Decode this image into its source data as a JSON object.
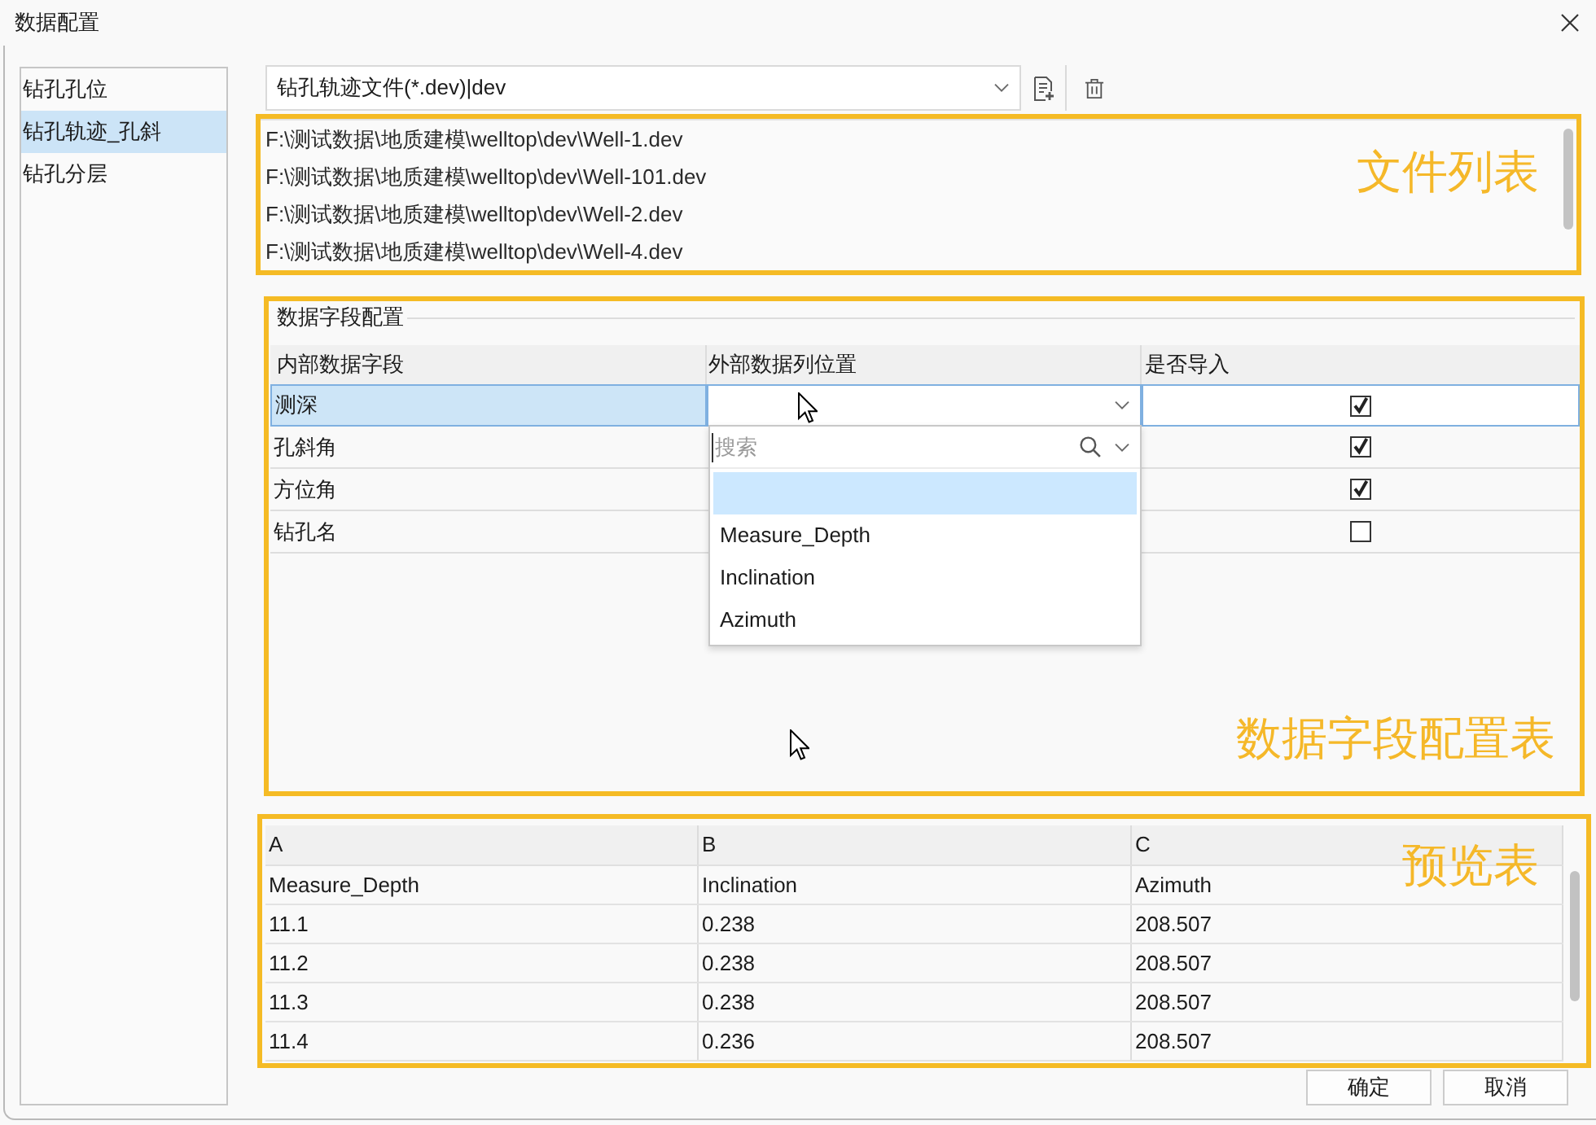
{
  "window": {
    "title": "数据配置"
  },
  "sidebar": {
    "items": [
      {
        "label": "钻孔孔位",
        "selected": false
      },
      {
        "label": "钻孔轨迹_孔斜",
        "selected": true
      },
      {
        "label": "钻孔分层",
        "selected": false
      }
    ]
  },
  "file_type": {
    "value": "钻孔轨迹文件(*.dev)|dev"
  },
  "file_list": {
    "items": [
      "F:\\测试数据\\地质建模\\welltop\\dev\\Well-1.dev",
      "F:\\测试数据\\地质建模\\welltop\\dev\\Well-101.dev",
      "F:\\测试数据\\地质建模\\welltop\\dev\\Well-2.dev",
      "F:\\测试数据\\地质建模\\welltop\\dev\\Well-4.dev"
    ],
    "annotation": "文件列表"
  },
  "field_config": {
    "title": "数据字段配置",
    "columns": [
      "内部数据字段",
      "外部数据列位置",
      "是否导入"
    ],
    "rows": [
      {
        "field": "测深",
        "imported": true,
        "selected": true
      },
      {
        "field": "孔斜角",
        "imported": true,
        "selected": false
      },
      {
        "field": "方位角",
        "imported": true,
        "selected": false
      },
      {
        "field": "钻孔名",
        "imported": false,
        "selected": false
      }
    ],
    "dropdown": {
      "expanded": true,
      "placeholder": "搜索",
      "options": [
        {
          "selected": true
        },
        {
          "label": "Measure_Depth",
          "selected": false
        },
        {
          "label": "Inclination",
          "selected": false
        },
        {
          "label": "Azimuth",
          "selected": false
        }
      ]
    },
    "annotation": "数据字段配置表"
  },
  "preview": {
    "columns": [
      "A",
      "B",
      "C"
    ],
    "rows": [
      [
        "Measure_Depth",
        "Inclination",
        "Azimuth"
      ],
      [
        "11.1",
        "0.238",
        "208.507"
      ],
      [
        "11.2",
        "0.238",
        "208.507"
      ],
      [
        "11.3",
        "0.238",
        "208.507"
      ],
      [
        "11.4",
        "0.236",
        "208.507"
      ]
    ],
    "annotation": "预览表"
  },
  "buttons": [
    {
      "label": "确定"
    },
    {
      "label": "取消"
    }
  ]
}
